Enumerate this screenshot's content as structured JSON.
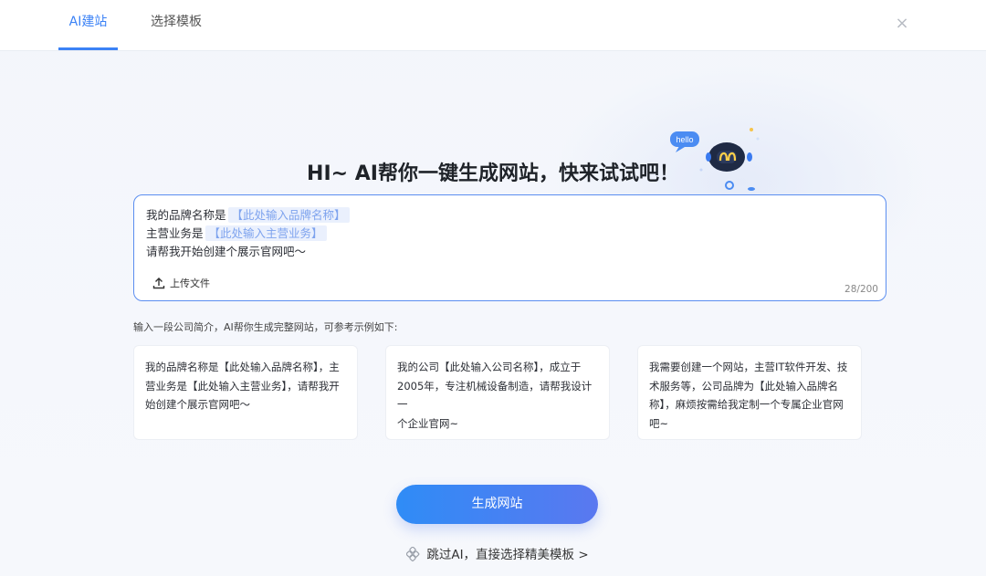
{
  "header": {
    "tabs": [
      {
        "label": "AI建站",
        "active": true
      },
      {
        "label": "选择模板",
        "active": false
      }
    ],
    "close_symbol": "×"
  },
  "hero": {
    "headline": "HI~ AI帮你一键生成网站，快来试试吧！",
    "robot_bubble": "hello"
  },
  "prompt": {
    "line1_prefix": "我的品牌名称是",
    "line1_slot": "【此处输入品牌名称】",
    "line2_prefix": "主营业务是",
    "line2_slot": "【此处输入主营业务】",
    "line3": "请帮我开始创建个展示官网吧～",
    "upload_label": "上传文件",
    "counter": "28/200"
  },
  "hint": "输入一段公司简介，AI帮你生成完整网站，可参考示例如下:",
  "examples": [
    {
      "lines": [
        "我的品牌名称是【此处输入品牌名称】，主",
        "营业务是【此处输入主营业务】，请帮我开",
        "始创建个展示官网吧～"
      ]
    },
    {
      "lines": [
        "我的公司【此处输入公司名称】，成立于",
        "2005年，专注机械设备制造，请帮我设计一",
        "个企业官网~"
      ]
    },
    {
      "lines": [
        "我需要创建一个网站，主营IT软件开发、技",
        "术服务等，公司品牌为【此处输入品牌名",
        "称】，麻烦按需给我定制一个专属企业官网",
        "吧~"
      ]
    }
  ],
  "generate_button": "生成网站",
  "skip_link": "跳过AI，直接选择精美模板 >",
  "colors": {
    "accent": "#3b82f6",
    "button_start": "#2f8cf6",
    "button_end": "#5a78f0",
    "slot_bg": "#eaf0fd",
    "slot_text": "#7ea3ee"
  }
}
